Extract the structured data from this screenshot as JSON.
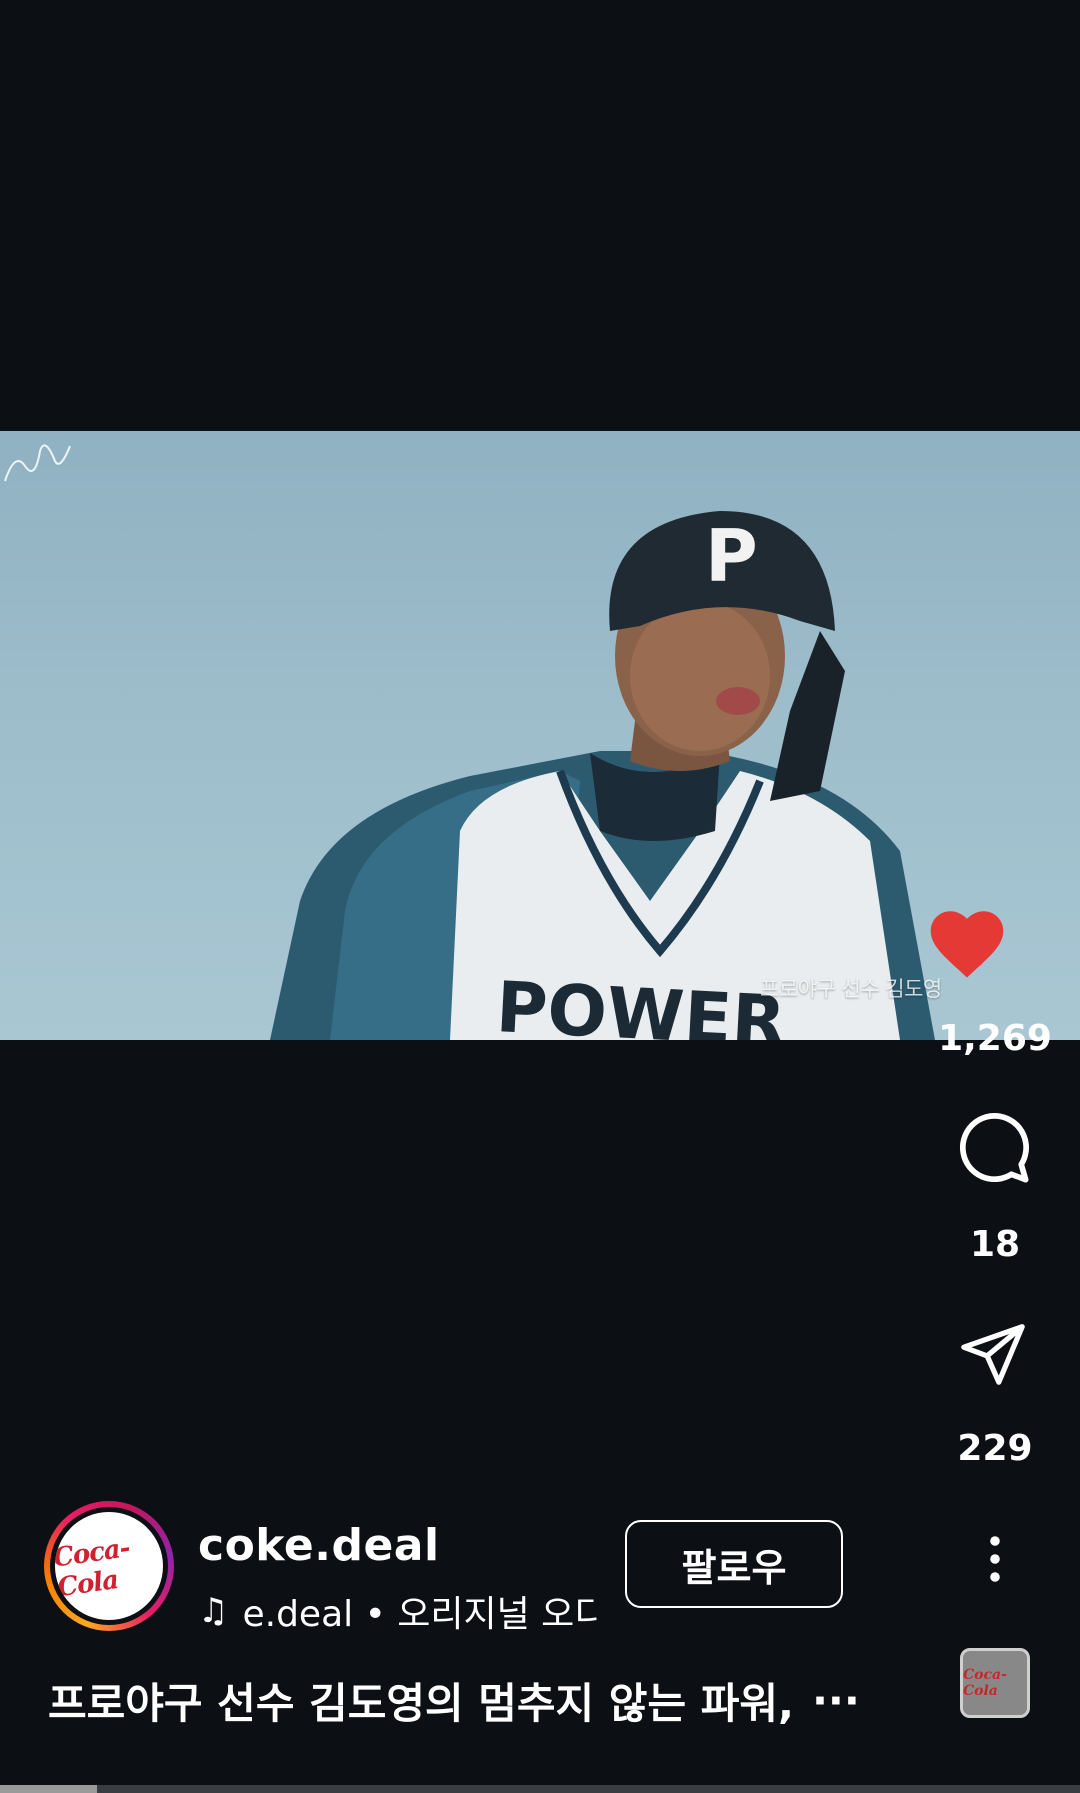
{
  "video": {
    "overlay_caption": "프로야구 선수 김도영",
    "jersey_letter": "P",
    "jersey_text": "POWER"
  },
  "actions": {
    "like_count": "1,269",
    "comment_count": "18",
    "share_count": "229",
    "like_icon": "heart-icon",
    "comment_icon": "speech-bubble-icon",
    "share_icon": "paper-plane-icon",
    "more_icon": "vertical-dots-icon",
    "like_color": "#e53935"
  },
  "profile": {
    "username": "coke.deal",
    "avatar_text": "Coca-Cola",
    "audio_note": "♫",
    "audio_text": "e.deal • 오리지널 오디",
    "follow_label": "팔로우"
  },
  "caption": {
    "text": "프로야구 선수 김도영의 멈추지 않는 파워,",
    "more": "···"
  },
  "audio_thumb": {
    "text": "Coca-Cola"
  },
  "playback": {
    "progress_fraction": 0.09
  }
}
